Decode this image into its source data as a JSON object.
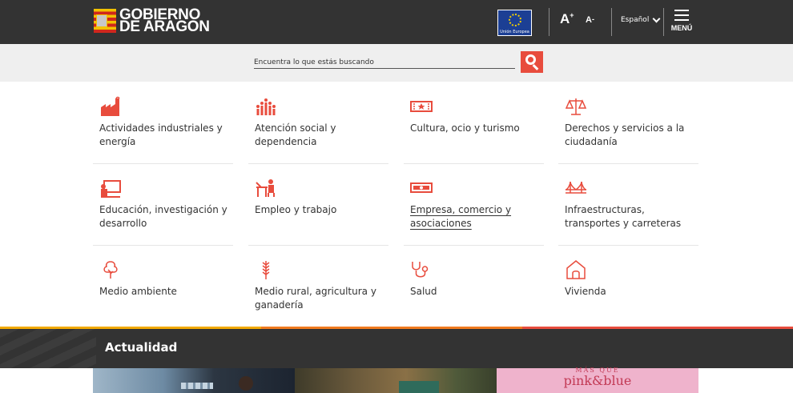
{
  "header": {
    "logo_line1": "GOBIERNO",
    "logo_line2": "DE ARAGON",
    "eu_label": "Unión Europea",
    "font_increase": "A",
    "font_increase_sup": "+",
    "font_decrease": "A",
    "font_decrease_sup": "-",
    "language": "Español",
    "menu_label": "MENÚ"
  },
  "search": {
    "placeholder": "Encuentra lo que estás buscando"
  },
  "categories": [
    {
      "label": "Actividades industriales y energía",
      "icon": "factory-icon"
    },
    {
      "label": "Atención social y dependencia",
      "icon": "people-group-icon"
    },
    {
      "label": "Cultura, ocio y turismo",
      "icon": "ticket-icon"
    },
    {
      "label": "Derechos y servicios a la ciudadanía",
      "icon": "scales-icon"
    },
    {
      "label": "Educación, investigación y desarrollo",
      "icon": "teacher-board-icon"
    },
    {
      "label": "Empleo y trabajo",
      "icon": "worker-desk-icon"
    },
    {
      "label": "Empresa, comercio y asociaciones",
      "icon": "banknote-icon"
    },
    {
      "label": "Infraestructuras, transportes y carreteras",
      "icon": "bridge-icon"
    },
    {
      "label": "Medio ambiente",
      "icon": "tree-icon"
    },
    {
      "label": "Medio rural, agricultura y ganadería",
      "icon": "wheat-icon"
    },
    {
      "label": "Salud",
      "icon": "stethoscope-icon"
    },
    {
      "label": "Vivienda",
      "icon": "house-icon"
    }
  ],
  "news": {
    "section_title": "Actualidad",
    "promo_line1": "MÁS QUE",
    "promo_line2": "pink&blue"
  },
  "colors": {
    "accent": "#e84c3d",
    "topbar": "#333333",
    "stripe_yellow": "#f2a900",
    "stripe_orange": "#f07a1f",
    "stripe_red": "#e84c3d"
  }
}
